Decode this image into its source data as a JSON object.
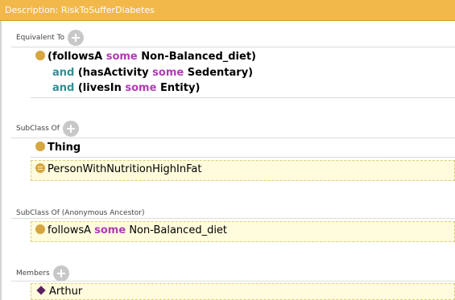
{
  "title": "Description: RiskToSufferDiabetes",
  "sections": {
    "equivalent": {
      "label": "Equivalent To",
      "line1": {
        "open": "(followsA ",
        "kw": "some",
        "rest": " Non-Balanced_diet)"
      },
      "line2": {
        "and": "and",
        "open": " (hasActivity ",
        "kw": "some",
        "rest": " Sedentary)"
      },
      "line3": {
        "and": "and",
        "open": " (livesIn ",
        "kw": "some",
        "rest": " Entity)"
      }
    },
    "subclass": {
      "label": "SubClass Of",
      "items": [
        "Thing",
        "PersonWithNutritionHighInFat"
      ]
    },
    "ancestor": {
      "label": "SubClass Of (Anonymous Ancestor)",
      "item": {
        "a": "followsA ",
        "kw": "some",
        "b": " Non-Balanced_diet"
      }
    },
    "members": {
      "label": "Members",
      "items": [
        "Arthur"
      ]
    }
  },
  "colors": {
    "titlebar": "#f3b84a",
    "keyword_some": "#b03bb5",
    "keyword_and": "#2f8f95",
    "class_dot": "#d6a640",
    "individual": "#5a2160",
    "highlight": "#fffbdc"
  },
  "icons": [
    "plus-icon",
    "class-dot-icon",
    "equivalent-class-icon",
    "individual-diamond-icon"
  ]
}
